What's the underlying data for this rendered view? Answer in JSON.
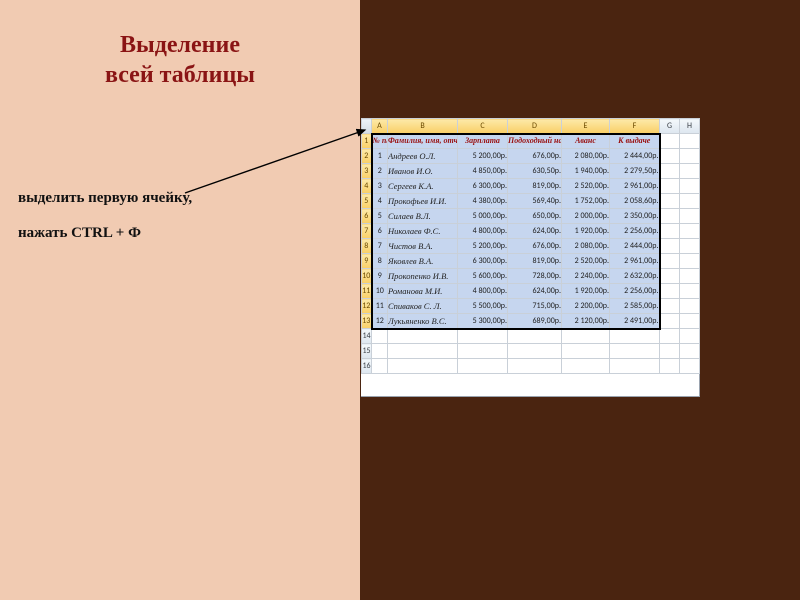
{
  "title_line1": "Выделение",
  "title_line2": "всей таблицы",
  "instr1": "выделить первую ячейку,",
  "instr2": "нажать CTRL + Ф",
  "columns": [
    "A",
    "B",
    "C",
    "D",
    "E",
    "F",
    "G",
    "H"
  ],
  "row_nums": [
    "1",
    "2",
    "3",
    "4",
    "5",
    "6",
    "7",
    "8",
    "9",
    "10",
    "11",
    "12",
    "13",
    "14",
    "15",
    "16"
  ],
  "headers": {
    "num": "№ п/п",
    "fio": "Фамилия, имя, отчество",
    "salary": "Зарплата",
    "tax": "Подоходный налог",
    "advance": "Аванс",
    "payout": "К выдаче"
  },
  "rows": [
    {
      "n": "1",
      "fio": "Андреев О.Л.",
      "c": "5 200,00р.",
      "d": "676,00р.",
      "e": "2 080,00р.",
      "f": "2 444,00р."
    },
    {
      "n": "2",
      "fio": "Иванов И.О.",
      "c": "4 850,00р.",
      "d": "630,50р.",
      "e": "1 940,00р.",
      "f": "2 279,50р."
    },
    {
      "n": "3",
      "fio": "Сергеев К.А.",
      "c": "6 300,00р.",
      "d": "819,00р.",
      "e": "2 520,00р.",
      "f": "2 961,00р."
    },
    {
      "n": "4",
      "fio": "Прокофьев И.И.",
      "c": "4 380,00р.",
      "d": "569,40р.",
      "e": "1 752,00р.",
      "f": "2 058,60р."
    },
    {
      "n": "5",
      "fio": "Силаев В.Л.",
      "c": "5 000,00р.",
      "d": "650,00р.",
      "e": "2 000,00р.",
      "f": "2 350,00р."
    },
    {
      "n": "6",
      "fio": "Николаев Ф.С.",
      "c": "4 800,00р.",
      "d": "624,00р.",
      "e": "1 920,00р.",
      "f": "2 256,00р."
    },
    {
      "n": "7",
      "fio": "Чистов В.А.",
      "c": "5 200,00р.",
      "d": "676,00р.",
      "e": "2 080,00р.",
      "f": "2 444,00р."
    },
    {
      "n": "8",
      "fio": "Яковлев В.А.",
      "c": "6 300,00р.",
      "d": "819,00р.",
      "e": "2 520,00р.",
      "f": "2 961,00р."
    },
    {
      "n": "9",
      "fio": "Прокопенко И.В.",
      "c": "5 600,00р.",
      "d": "728,00р.",
      "e": "2 240,00р.",
      "f": "2 632,00р."
    },
    {
      "n": "10",
      "fio": "Романова М.И.",
      "c": "4 800,00р.",
      "d": "624,00р.",
      "e": "1 920,00р.",
      "f": "2 256,00р."
    },
    {
      "n": "11",
      "fio": "Спиваков С. Л.",
      "c": "5 500,00р.",
      "d": "715,00р.",
      "e": "2 200,00р.",
      "f": "2 585,00р."
    },
    {
      "n": "12",
      "fio": "Лукьяненко В.С.",
      "c": "5 300,00р.",
      "d": "689,00р.",
      "e": "2 120,00р.",
      "f": "2 491,00р."
    }
  ]
}
